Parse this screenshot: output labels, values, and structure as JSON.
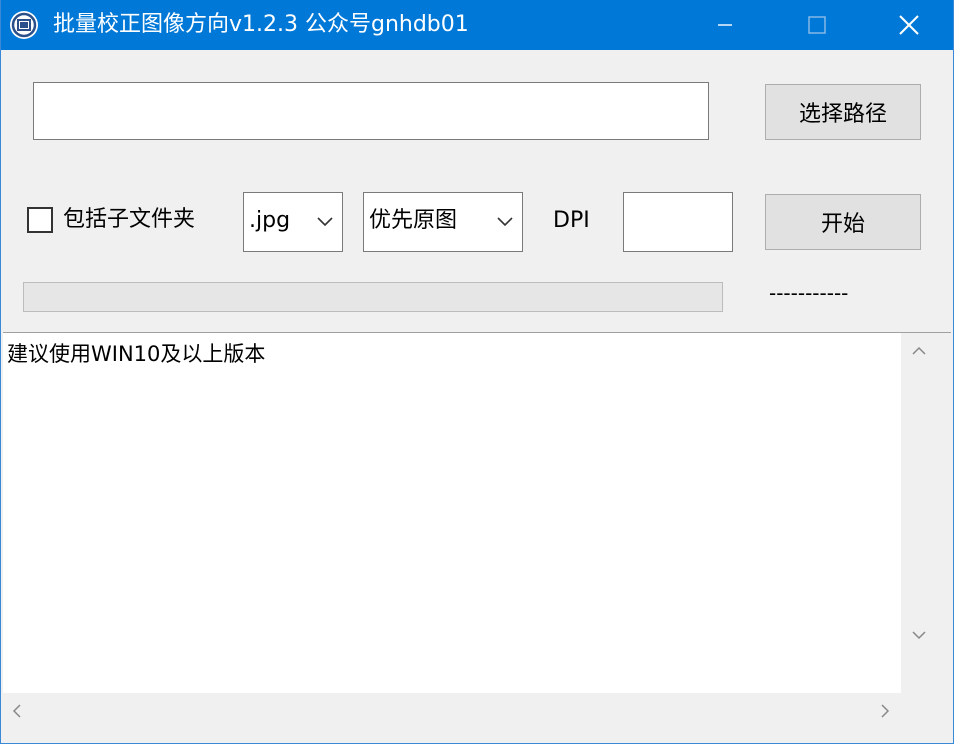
{
  "window": {
    "title": "批量校正图像方向v1.2.3 公众号gnhdb01"
  },
  "form": {
    "path_value": "",
    "select_path_label": "选择路径",
    "include_subfolders_label": "包括子文件夹",
    "include_subfolders_checked": false,
    "extension_selected": ".jpg",
    "mode_selected": "优先原图",
    "dpi_label": "DPI",
    "dpi_value": "",
    "start_label": "开始",
    "progress_percent": 0,
    "status_text": "-----------"
  },
  "log": {
    "text": "建议使用WIN10及以上版本"
  },
  "colors": {
    "titlebar": "#0078d7",
    "window_bg": "#f0f0f0",
    "button_bg": "#e1e1e1"
  }
}
